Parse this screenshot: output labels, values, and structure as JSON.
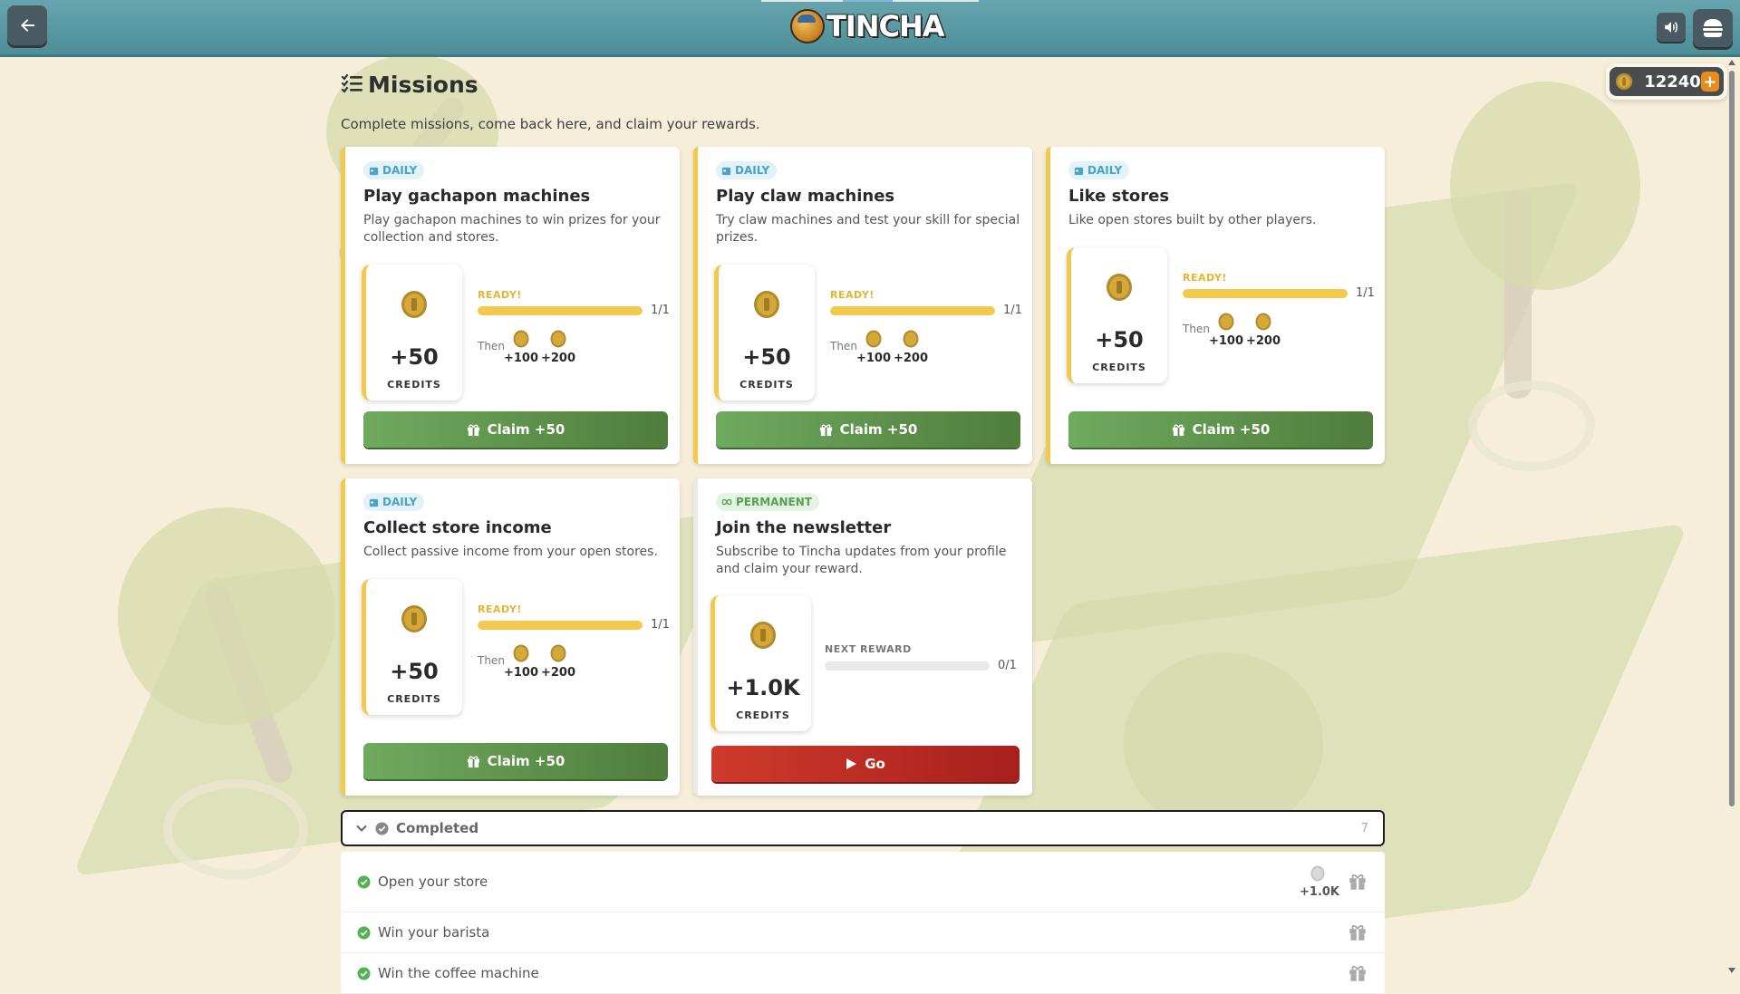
{
  "app": {
    "logo_text": "TINCHA"
  },
  "header": {
    "credits": "12240"
  },
  "page": {
    "title": "Missions",
    "subtitle": "Complete missions, come back here, and claim your rewards."
  },
  "cards": [
    {
      "tag": "DAILY",
      "title": "Play gachapon machines",
      "desc": "Play gachapon machines to win prizes for your collection and stores.",
      "reward": "+50",
      "reward_label": "CREDITS",
      "status": "READY!",
      "progress": "1/1",
      "progress_fraction": 1,
      "then_label": "Then",
      "next_rewards": [
        "+100",
        "+200"
      ],
      "button": "Claim +50"
    },
    {
      "tag": "DAILY",
      "title": "Play claw machines",
      "desc": "Try claw machines and test your skill for special prizes.",
      "reward": "+50",
      "reward_label": "CREDITS",
      "status": "READY!",
      "progress": "1/1",
      "progress_fraction": 1,
      "then_label": "Then",
      "next_rewards": [
        "+100",
        "+200"
      ],
      "button": "Claim +50"
    },
    {
      "tag": "DAILY",
      "title": "Like stores",
      "desc": "Like open stores built by other players.",
      "reward": "+50",
      "reward_label": "CREDITS",
      "status": "READY!",
      "progress": "1/1",
      "progress_fraction": 1,
      "then_label": "Then",
      "next_rewards": [
        "+100",
        "+200"
      ],
      "button": "Claim +50"
    },
    {
      "tag": "DAILY",
      "title": "Collect store income",
      "desc": "Collect passive income from your open stores.",
      "reward": "+50",
      "reward_label": "CREDITS",
      "status": "READY!",
      "progress": "1/1",
      "progress_fraction": 1,
      "then_label": "Then",
      "next_rewards": [
        "+100",
        "+200"
      ],
      "button": "Claim +50"
    },
    {
      "tag": "PERMANENT",
      "title": "Join the newsletter",
      "desc": "Subscribe to Tincha updates from your profile and claim your reward.",
      "reward": "+1.0K",
      "reward_label": "CREDITS",
      "status": "NEXT REWARD",
      "progress": "0/1",
      "progress_fraction": 0,
      "button": "Go"
    }
  ],
  "completed": {
    "label": "Completed",
    "count": "7",
    "items": [
      {
        "name": "Open your store",
        "reward": "+1.0K"
      },
      {
        "name": "Win your barista"
      },
      {
        "name": "Win the coffee machine"
      }
    ]
  },
  "colors": {
    "accent_yellow": "#f2c94c",
    "claim_green": "#5a8f48",
    "go_red": "#c0302a",
    "topbar": "#5a9aa3"
  }
}
